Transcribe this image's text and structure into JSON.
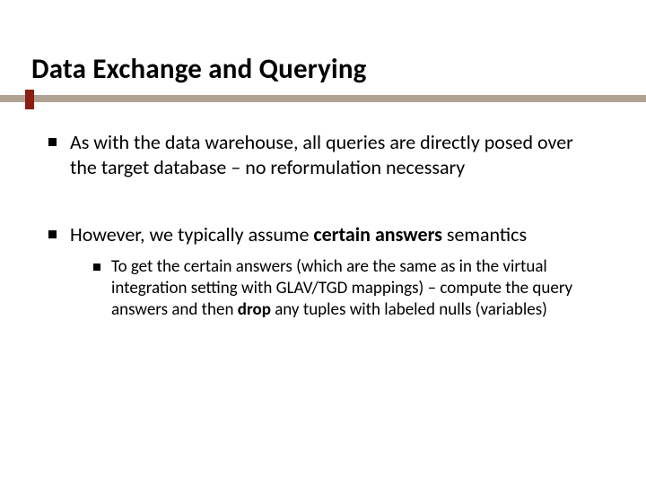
{
  "title": "Data Exchange and Querying",
  "bullets": {
    "b1": "As with the data warehouse, all queries are directly posed over the target database – no reformulation necessary",
    "b2_pre": "However, we typically assume ",
    "b2_bold": "certain answers",
    "b2_post": " semantics",
    "sub_pre": "To get the certain answers (which are the same as in the virtual integration setting with GLAV/TGD mappings) – compute the query answers and then ",
    "sub_bold": "drop",
    "sub_post": " any tuples with labeled nulls (variables)"
  }
}
